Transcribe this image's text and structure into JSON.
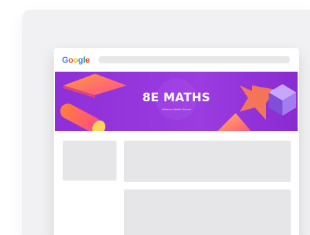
{
  "browser": {
    "logo": {
      "letters": [
        "G",
        "o",
        "o",
        "g",
        "l",
        "e"
      ],
      "colors": [
        "#4285f4",
        "#ea4335",
        "#fbbc05",
        "#4285f4",
        "#34a853",
        "#ea4335"
      ]
    }
  },
  "banner": {
    "title": "8E MATHS",
    "subtitle": "Bellevue Middle School",
    "background": "#9336dc"
  },
  "colors": {
    "backdrop": "#f1f1f3",
    "placeholder": "#e6e6e8",
    "addressbar": "#e8e8ea"
  }
}
